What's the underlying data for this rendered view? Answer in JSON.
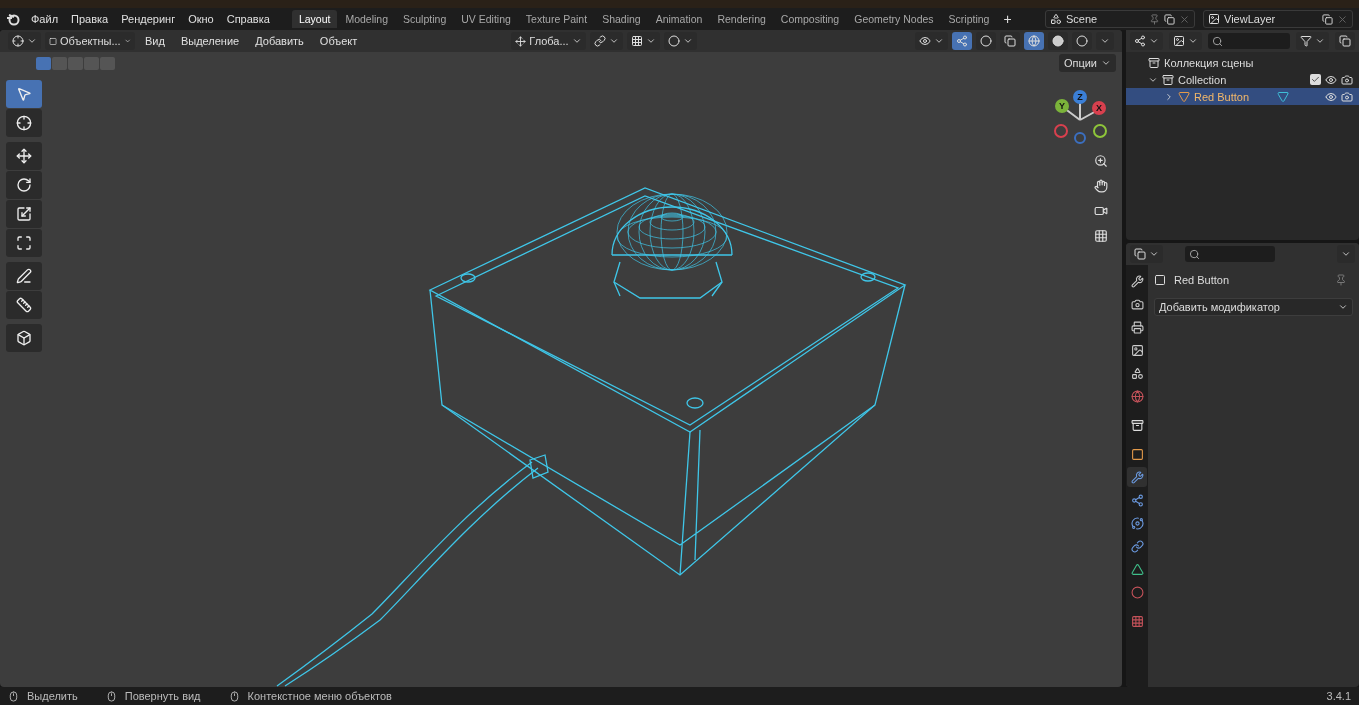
{
  "menu": [
    "Файл",
    "Правка",
    "Рендеринг",
    "Окно",
    "Справка"
  ],
  "workspaces": [
    {
      "label": "Layout",
      "selected": true
    },
    {
      "label": "Modeling",
      "selected": false
    },
    {
      "label": "Sculpting",
      "selected": false
    },
    {
      "label": "UV Editing",
      "selected": false
    },
    {
      "label": "Texture Paint",
      "selected": false
    },
    {
      "label": "Shading",
      "selected": false
    },
    {
      "label": "Animation",
      "selected": false
    },
    {
      "label": "Rendering",
      "selected": false
    },
    {
      "label": "Compositing",
      "selected": false
    },
    {
      "label": "Geometry Nodes",
      "selected": false
    },
    {
      "label": "Scripting",
      "selected": false
    }
  ],
  "add_workspace": "+",
  "scene": "Scene",
  "view_layer": "ViewLayer",
  "viewport": {
    "mode": "Объектны...",
    "menus": [
      "Вид",
      "Выделение",
      "Добавить",
      "Объект"
    ],
    "orientation": "Глоба...",
    "options": "Опции",
    "tools": [
      {
        "kind": "select",
        "selected": true
      },
      {
        "kind": "cursor",
        "selected": false
      },
      {
        "kind": "move",
        "selected": false
      },
      {
        "kind": "rotate",
        "selected": false
      },
      {
        "kind": "scale",
        "selected": false
      },
      {
        "kind": "transform",
        "selected": false
      },
      {
        "kind": "annotate",
        "selected": false
      },
      {
        "kind": "measure",
        "selected": false
      },
      {
        "kind": "add_cube",
        "selected": false
      }
    ],
    "gizmo": {
      "z": "Z",
      "y": "Y",
      "x": "X"
    }
  },
  "outliner": {
    "root": "Коллекция сцены",
    "items": [
      {
        "label": "Collection",
        "expanded": true,
        "checked": true,
        "selected": false,
        "children": [
          {
            "label": "Red Button",
            "expanded": false,
            "selected": true
          }
        ]
      }
    ]
  },
  "properties": {
    "object_name": "Red Button",
    "add_modifier": "Добавить модификатор",
    "tabs": [
      {
        "kind": "tool",
        "selected": false
      },
      {
        "kind": "render",
        "selected": false
      },
      {
        "kind": "output",
        "selected": false
      },
      {
        "kind": "view_layer",
        "selected": false
      },
      {
        "kind": "scene",
        "selected": false
      },
      {
        "kind": "world",
        "selected": false
      },
      {
        "kind": "collection",
        "selected": false
      },
      {
        "kind": "object",
        "selected": false
      },
      {
        "kind": "modifiers",
        "selected": true
      },
      {
        "kind": "particles",
        "selected": false
      },
      {
        "kind": "physics",
        "selected": false
      },
      {
        "kind": "constraints",
        "selected": false
      },
      {
        "kind": "data",
        "selected": false
      },
      {
        "kind": "material",
        "selected": false
      },
      {
        "kind": "texture",
        "selected": false
      }
    ]
  },
  "status": [
    "Выделить",
    "Повернуть вид",
    "Контекстное меню объектов"
  ],
  "version": "3.4.1"
}
